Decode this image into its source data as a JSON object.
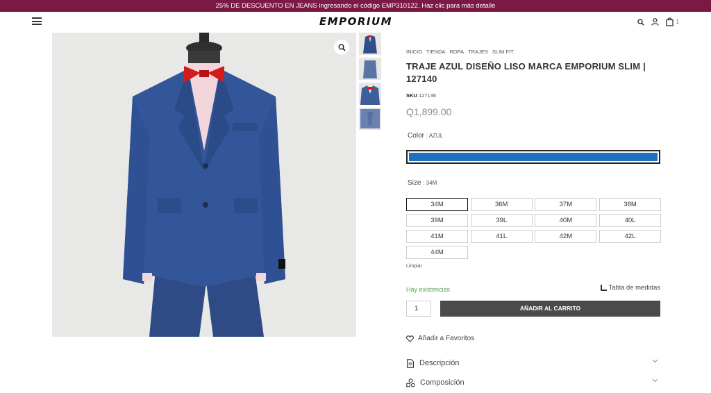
{
  "promo": {
    "text": "25% DE DESCUENTO EN JEANS ingresando el código EMP310122. Haz clic para más detalle"
  },
  "header": {
    "logo": "EMPORIUM",
    "icons": [
      "menu-icon",
      "search-icon",
      "user-icon",
      "bag-icon"
    ],
    "cart_count": "1"
  },
  "product": {
    "breadcrumb": [
      "INICIO",
      "TIENDA",
      "ROPA",
      "TRAJES",
      "SLIM FIT"
    ],
    "title": "TRAJE AZUL DISEÑO LISO MARCA EMPORIUM SLIM | 127140",
    "sku_label": "SKU",
    "sku": "127138",
    "price": "Q1,899.00",
    "color_label": "Color",
    "color_value": ": AZUL",
    "color_hex": "#1f70c1",
    "size_label": "Size",
    "size_value": ": 34M",
    "sizes": [
      "34M",
      "36M",
      "37M",
      "38M",
      "39M",
      "39L",
      "40M",
      "40L",
      "41M",
      "41L",
      "42M",
      "42L",
      "44M"
    ],
    "selected_size": "34M",
    "clear_label": "Limpiar",
    "stock": "Hay existencias",
    "measures_label": "Tabla de medidas",
    "quantity": "1",
    "add_to_cart": "AÑADIR AL CARRITO",
    "favorites": "Añadir a Favoritos",
    "accordion": [
      "Descripción",
      "Composición"
    ]
  },
  "colors": {
    "promo_bg": "#7a1a44",
    "button_bg": "#4b4b4b",
    "stock_green": "#5aa256",
    "suit_blue": "#2e4f8c"
  }
}
